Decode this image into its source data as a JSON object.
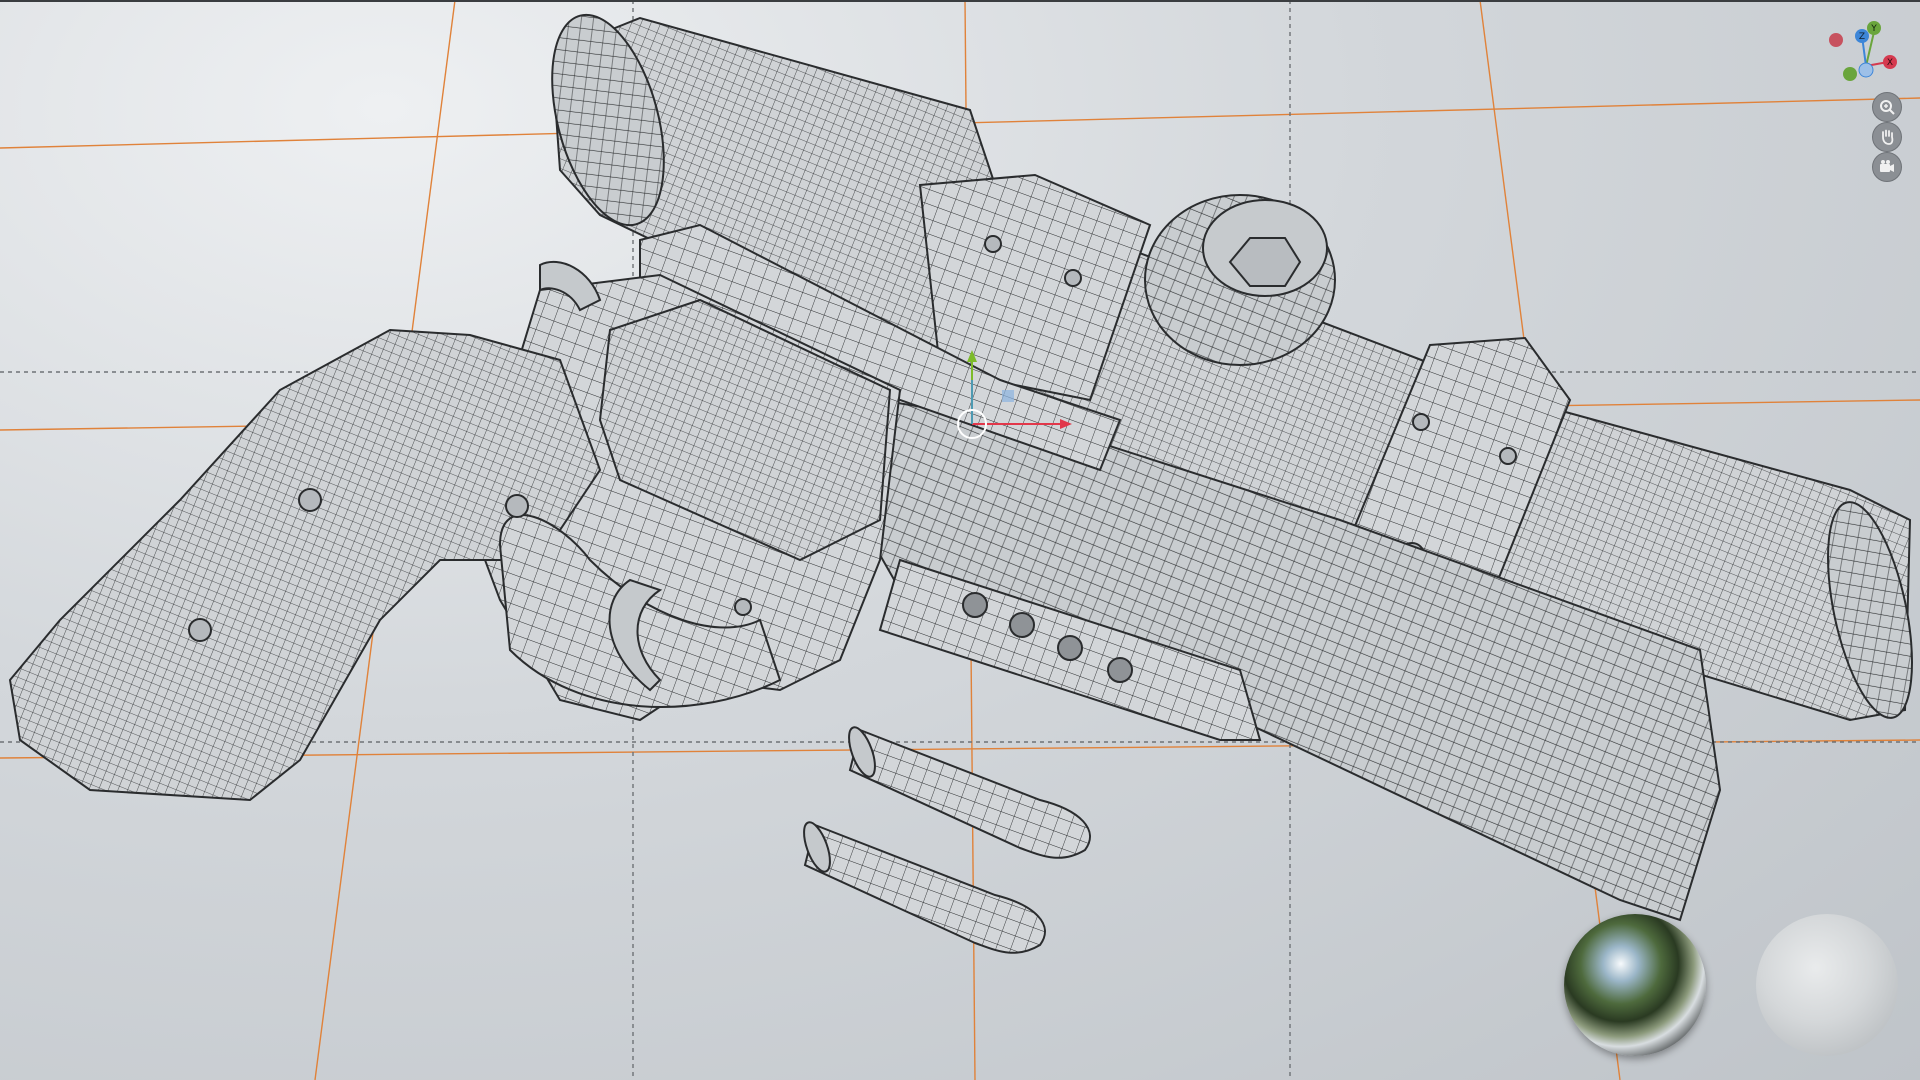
{
  "viewport": {
    "colors": {
      "grid_line": "#e0823a",
      "grid_dashed": "#6e7276",
      "wire": "#2a2c2e",
      "model_fill": "#d2d5d8",
      "model_shade": "#b5b9bd",
      "x_axis": "#e2374a",
      "y_axis": "#7dbb2a",
      "z_axis": "#3f8fe0",
      "gizmo_red": "#c7525f",
      "gizmo_green": "#6aa53c",
      "gizmo_blue": "#3d86d8"
    }
  },
  "gizmo": {
    "axes": [
      {
        "label": "Z",
        "color": "#3d86d8"
      },
      {
        "label": "Y",
        "color": "#6aa53c"
      },
      {
        "label": "X",
        "color": "#d53a4f"
      }
    ]
  },
  "nav_buttons": [
    {
      "icon": "zoom-icon"
    },
    {
      "icon": "hand-pan-icon"
    },
    {
      "icon": "camera-icon"
    }
  ],
  "preview_spheres": [
    {
      "name": "hdri-reflection-sphere"
    },
    {
      "name": "clay-shading-sphere"
    }
  ]
}
